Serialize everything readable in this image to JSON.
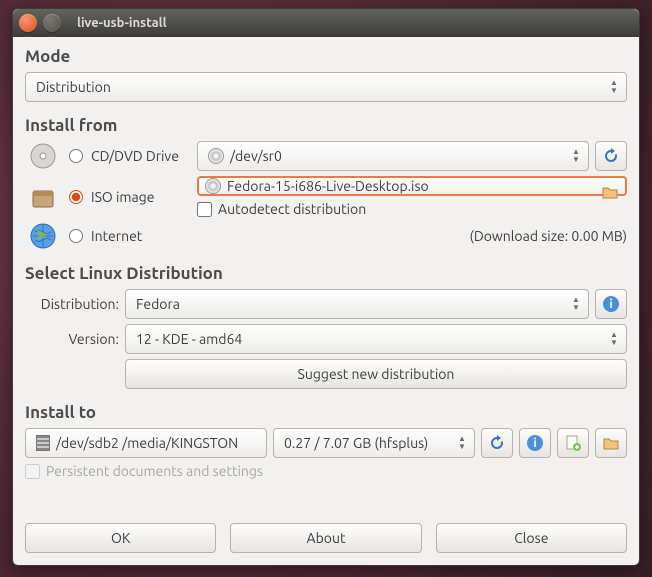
{
  "window": {
    "title": "live-usb-install"
  },
  "mode": {
    "heading": "Mode",
    "value": "Distribution"
  },
  "install_from": {
    "heading": "Install from",
    "cd_label": "CD/DVD Drive",
    "cd_device": "/dev/sr0",
    "iso_label": "ISO image",
    "iso_file": "Fedora-15-i686-Live-Desktop.iso",
    "autodetect_label": "Autodetect distribution",
    "internet_label": "Internet",
    "download_size": "(Download size: 0.00 MB)",
    "selected": "iso",
    "autodetect_checked": false
  },
  "select_dist": {
    "heading": "Select Linux Distribution",
    "distribution_label": "Distribution:",
    "distribution_value": "Fedora",
    "version_label": "Version:",
    "version_value": "12 - KDE - amd64",
    "suggest_label": "Suggest new distribution"
  },
  "install_to": {
    "heading": "Install to",
    "device": "/dev/sdb2 /media/KINGSTON",
    "space": "0.27 / 7.07 GB (hfsplus)",
    "persistent_label": "Persistent documents and settings",
    "persistent_enabled": false
  },
  "buttons": {
    "ok": "OK",
    "about": "About",
    "close": "Close"
  }
}
